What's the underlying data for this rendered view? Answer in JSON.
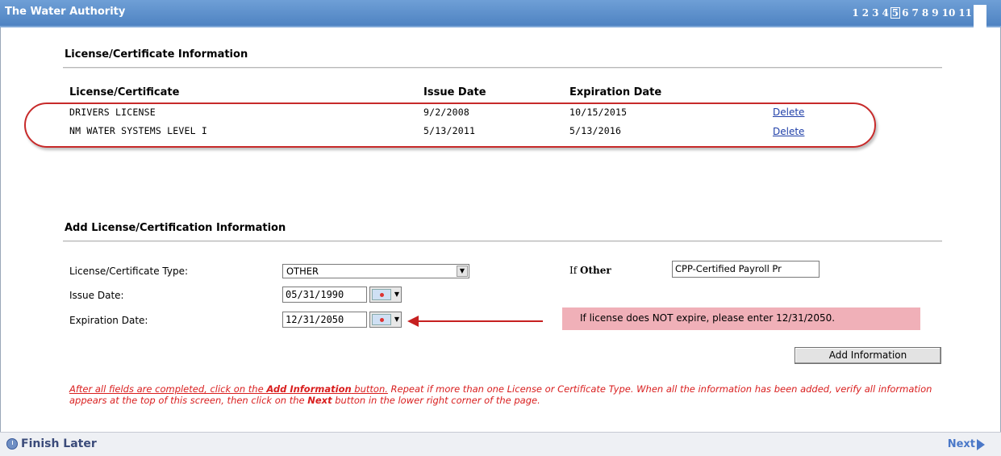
{
  "app": {
    "title": "The Water Authority"
  },
  "pager": {
    "pages": [
      "1",
      "2",
      "3",
      "4",
      "5",
      "6",
      "7",
      "8",
      "9",
      "10",
      "11"
    ],
    "current": "5"
  },
  "license_section": {
    "heading": "License/Certificate Information",
    "columns": {
      "license": "License/Certificate",
      "issue": "Issue Date",
      "expiration": "Expiration Date"
    },
    "rows": [
      {
        "license": "DRIVERS LICENSE",
        "issue": "9/2/2008",
        "expiration": "10/15/2015",
        "action": "Delete"
      },
      {
        "license": "NM WATER SYSTEMS LEVEL I",
        "issue": "5/13/2011",
        "expiration": "5/13/2016",
        "action": "Delete"
      }
    ]
  },
  "add_section": {
    "heading": "Add License/Certification Information",
    "type_label": "License/Certificate Type:",
    "type_value": "OTHER",
    "issue_label": "Issue Date:",
    "issue_value": "05/31/1990",
    "expiration_label": "Expiration Date:",
    "expiration_value": "12/31/2050",
    "if_prefix": "If",
    "if_other": "Other",
    "other_value": "CPP-Certified Payroll Pr",
    "note": "If license does NOT expire, please enter 12/31/2050.",
    "add_button": "Add Information"
  },
  "instructions": {
    "part1": "After all fields are completed, click on the ",
    "part2": "Add Information",
    "part3": " button.",
    "part4": " Repeat if more than one License or Certificate Type. When all the information has been added, verify all information appears at the top of this screen, then click on the ",
    "part5": "Next",
    "part6": " button in the lower right corner of the page."
  },
  "footer": {
    "finish_later": "Finish Later",
    "next": "Next"
  },
  "colors": {
    "title_bar": "#5a8ccb",
    "highlight_oval": "#c72a2a",
    "note_bg": "#f0b0b8",
    "instruction_text": "#d91e1e"
  }
}
